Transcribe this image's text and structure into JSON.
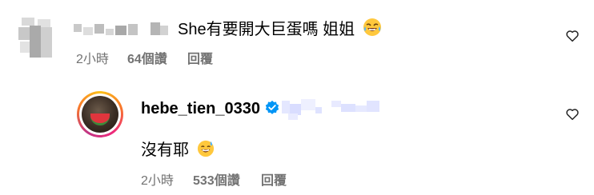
{
  "comment": {
    "text": "She有要開大巨蛋嗎 姐姐",
    "time": "2小時",
    "likes": "64個讚",
    "reply_label": "回覆",
    "emoji": "rolling-on-floor-laughing-emoji",
    "like_icon": "heart-outline-icon"
  },
  "reply": {
    "username": "hebe_tien_0330",
    "verified_icon": "verified-badge-icon",
    "text": "沒有耶",
    "time": "2小時",
    "likes": "533個讚",
    "reply_label": "回覆",
    "emoji": "grinning-sweat-emoji",
    "like_icon": "heart-outline-icon"
  },
  "colors": {
    "meta_text": "#737373",
    "verified": "#0095f6",
    "blur": "#e7e9ff"
  }
}
